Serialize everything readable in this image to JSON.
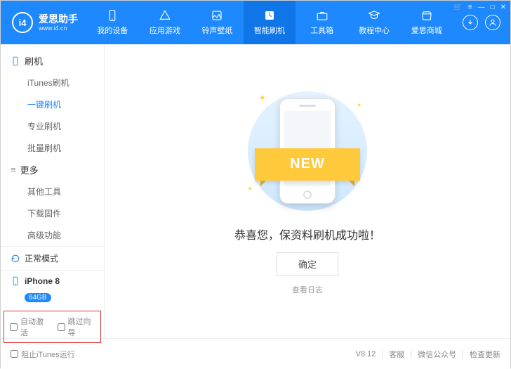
{
  "header": {
    "logo_letters": "i4",
    "brand": "爱思助手",
    "site": "www.i4.cn",
    "nav": [
      {
        "label": "我的设备",
        "active": false
      },
      {
        "label": "应用游戏",
        "active": false
      },
      {
        "label": "铃声壁纸",
        "active": false
      },
      {
        "label": "智能刷机",
        "active": true
      },
      {
        "label": "工具箱",
        "active": false
      },
      {
        "label": "教程中心",
        "active": false
      },
      {
        "label": "爱思商城",
        "active": false
      }
    ]
  },
  "sidebar": {
    "group1": {
      "title": "刷机",
      "items": [
        {
          "label": "iTunes刷机",
          "active": false
        },
        {
          "label": "一键刷机",
          "active": true
        },
        {
          "label": "专业刷机",
          "active": false
        },
        {
          "label": "批量刷机",
          "active": false
        }
      ]
    },
    "group2": {
      "title": "更多",
      "items": [
        {
          "label": "其他工具",
          "active": false
        },
        {
          "label": "下载固件",
          "active": false
        },
        {
          "label": "高级功能",
          "active": false
        }
      ]
    },
    "mode": "正常模式",
    "device_name": "iPhone 8",
    "device_storage": "64GB",
    "auto_activate": "自动激活",
    "skip_guide": "跳过向导"
  },
  "main": {
    "ribbon": "NEW",
    "success": "恭喜您，保资料刷机成功啦！",
    "ok": "确定",
    "view_log": "查看日志"
  },
  "footer": {
    "block_itunes": "阻止iTunes运行",
    "version": "V8.12",
    "support": "客服",
    "wechat": "微信公众号",
    "update": "检查更新"
  }
}
